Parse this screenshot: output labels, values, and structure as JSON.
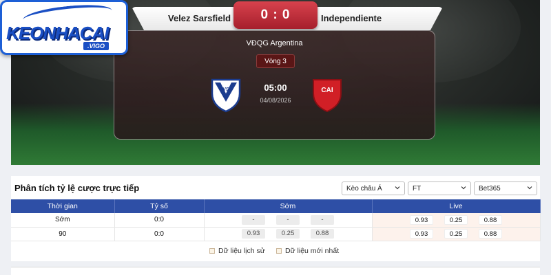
{
  "logo": {
    "text": "KEONHACAI",
    "sub": ".VIGO"
  },
  "match": {
    "home_team": "Velez Sarsfield",
    "away_team": "Independiente",
    "score": "0 : 0",
    "league": "VĐQG Argentina",
    "round": "Vòng 3",
    "time": "05:00",
    "date": "04/08/2026",
    "home_crest": "velez-sarsfield-crest-icon",
    "away_crest": "independiente-crest-icon"
  },
  "analysis": {
    "title": "Phân tích tỷ lệ cược trực tiếp",
    "filters": [
      {
        "value": "Kèo châu Á"
      },
      {
        "value": "FT"
      },
      {
        "value": "Bet365"
      }
    ],
    "headers": {
      "time": "Thời gian",
      "score": "Tỷ số",
      "early": "Sớm",
      "live": "Live"
    },
    "rows": [
      {
        "time": "Sớm",
        "score": "0:0",
        "early": [
          "-",
          "-",
          "-"
        ],
        "live": [
          "0.93",
          "0.25",
          "0.88"
        ]
      },
      {
        "time": "90",
        "score": "0:0",
        "early": [
          "0.93",
          "0.25",
          "0.88"
        ],
        "live": [
          "0.93",
          "0.25",
          "0.88"
        ]
      }
    ],
    "legend": {
      "history": "Dữ liệu lịch sử",
      "latest": "Dữ liệu mới nhất"
    }
  },
  "colors": {
    "header_blue": "#2e4fa6",
    "score_red": "#c2303c",
    "live_bg": "#fdf2ec"
  }
}
